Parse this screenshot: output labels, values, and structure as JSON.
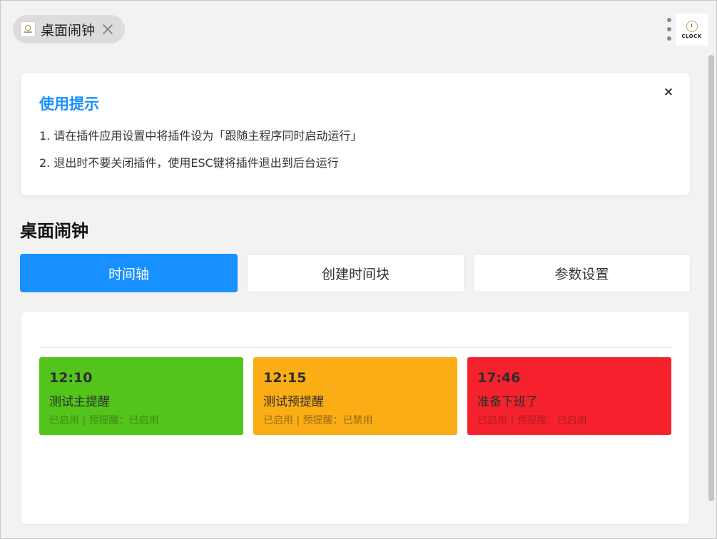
{
  "header": {
    "tab_title": "桌面闹钟",
    "tab_icon": "clock-logo-icon",
    "logo_text": "CLOCK",
    "mini_logo_text": "CLOCK"
  },
  "tips": {
    "title": "使用提示",
    "close_label": "×",
    "lines": [
      "1. 请在插件应用设置中将插件设为「跟随主程序同时启动运行」",
      "2. 退出时不要关闭插件，使用ESC键将插件退出到后台运行"
    ]
  },
  "page": {
    "heading": "桌面闹钟"
  },
  "tabs": [
    {
      "label": "时间轴",
      "active": true
    },
    {
      "label": "创建时间块",
      "active": false
    },
    {
      "label": "参数设置",
      "active": false
    }
  ],
  "timeline": {
    "blocks": [
      {
        "time": "12:10",
        "name": "测试主提醒",
        "status": "已启用 | 预提醒：已启用",
        "color": "#52c41a",
        "status_color": "#3f8a16"
      },
      {
        "time": "12:15",
        "name": "测试预提醒",
        "status": "已启用 | 预提醒：已禁用",
        "color": "#faad14",
        "status_color": "#9a6a12"
      },
      {
        "time": "17:46",
        "name": "准备下班了",
        "status": "已启用 | 预提醒：已启用",
        "color": "#f5222d",
        "status_color": "#b31a22"
      }
    ]
  },
  "colors": {
    "accent": "#1890ff"
  }
}
